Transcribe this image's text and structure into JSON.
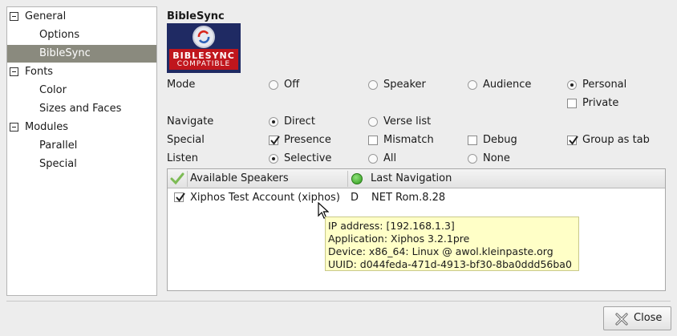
{
  "tree": {
    "general": "General",
    "options": "Options",
    "biblesync": "BibleSync",
    "fonts": "Fonts",
    "color": "Color",
    "sizes_faces": "Sizes and Faces",
    "modules": "Modules",
    "parallel": "Parallel",
    "special": "Special"
  },
  "panel": {
    "title": "BibleSync",
    "logo_word1": "BIBLESYNC",
    "logo_word2": "COMPATIBLE"
  },
  "mode": {
    "label": "Mode",
    "off": "Off",
    "speaker": "Speaker",
    "audience": "Audience",
    "personal": "Personal",
    "private": "Private"
  },
  "navigate": {
    "label": "Navigate",
    "direct": "Direct",
    "verse_list": "Verse list"
  },
  "special": {
    "label": "Special",
    "presence": "Presence",
    "mismatch": "Mismatch",
    "debug": "Debug",
    "group_as_tab": "Group as tab"
  },
  "listen": {
    "label": "Listen",
    "selective": "Selective",
    "all": "All",
    "none": "None"
  },
  "speakers": {
    "col_available": "Available Speakers",
    "col_last_nav": "Last Navigation",
    "rows": [
      {
        "name": "Xiphos Test Account (xiphos)",
        "flag": "D",
        "nav": "NET Rom.8.28",
        "checked": true
      }
    ]
  },
  "tooltip": {
    "ip": "IP address: [192.168.1.3]",
    "app": "Application: Xiphos 3.2.1pre",
    "device": "Device: x86_64: Linux @ awol.kleinpaste.org",
    "uuid": "UUID: d044feda-471d-4913-bf30-8ba0ddd56ba0"
  },
  "buttons": {
    "close": "Close"
  },
  "colors": {
    "selected_row": "#8a8a7e",
    "tooltip_bg": "#ffffc7",
    "logo_blue": "#1f2a63",
    "logo_red": "#c0161d",
    "presence_green": "#2e9a1b"
  }
}
